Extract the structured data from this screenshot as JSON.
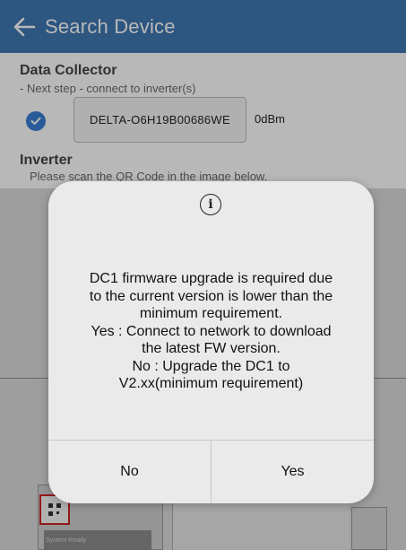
{
  "header": {
    "title": "Search Device",
    "back_icon": "arrow-left-icon",
    "background": "#3f78b3"
  },
  "data_collector": {
    "title": "Data Collector",
    "subtitle": "- Next step - connect to inverter(s)",
    "device": {
      "selected": true,
      "name": "DELTA-O6H19B00686WE",
      "signal": "0dBm"
    }
  },
  "inverter": {
    "title": "Inverter",
    "instruction": "Please scan the QR Code in the image below.",
    "device_label": "System Ready"
  },
  "dialog": {
    "icon": "info-icon",
    "message": "DC1 firmware upgrade is required due\nto the current version is lower than the\nminimum requirement.\nYes : Connect to network to download\nthe latest FW version.\nNo  : Upgrade the DC1 to\nV2.xx(minimum requirement)",
    "buttons": {
      "no": "No",
      "yes": "Yes"
    }
  },
  "colors": {
    "accent": "#3b7fd4",
    "qr_highlight": "#cc2222"
  }
}
